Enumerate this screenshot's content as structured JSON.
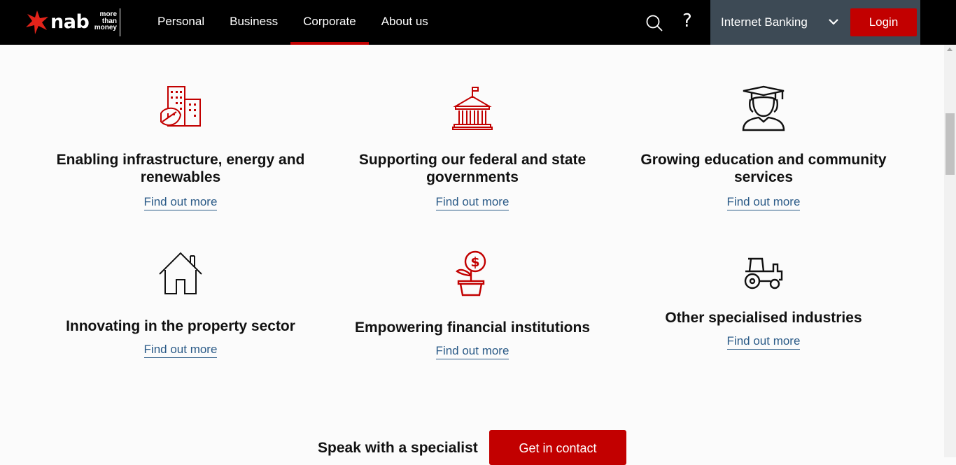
{
  "brand": {
    "name": "nab",
    "tagline": [
      "more",
      "than",
      "money"
    ],
    "primary_color": "#c20000",
    "header_bg": "#000000",
    "panel_bg": "#3d4a55"
  },
  "nav": {
    "items": [
      "Personal",
      "Business",
      "Corporate",
      "About us"
    ],
    "active": "Corporate"
  },
  "header": {
    "search_icon": "search-icon",
    "help_icon": "help-icon",
    "help_glyph": "?",
    "internet_banking_label": "Internet Banking",
    "login_label": "Login"
  },
  "cards": [
    {
      "icon": "building-leaf-icon",
      "title": "Enabling infrastructure, energy and renewables",
      "link": "Find out more"
    },
    {
      "icon": "government-building-icon",
      "title": "Supporting our federal and state governments",
      "link": "Find out more"
    },
    {
      "icon": "graduate-icon",
      "title": "Growing education and community services",
      "link": "Find out more"
    },
    {
      "icon": "house-icon",
      "title": "Innovating in the property sector",
      "link": "Find out more"
    },
    {
      "icon": "money-plant-icon",
      "title": "Empowering financial institutions",
      "link": "Find out more"
    },
    {
      "icon": "tractor-icon",
      "title": "Other specialised industries",
      "link": "Find out more"
    }
  ],
  "cta": {
    "text": "Speak with a specialist",
    "button_label": "Get in contact"
  }
}
